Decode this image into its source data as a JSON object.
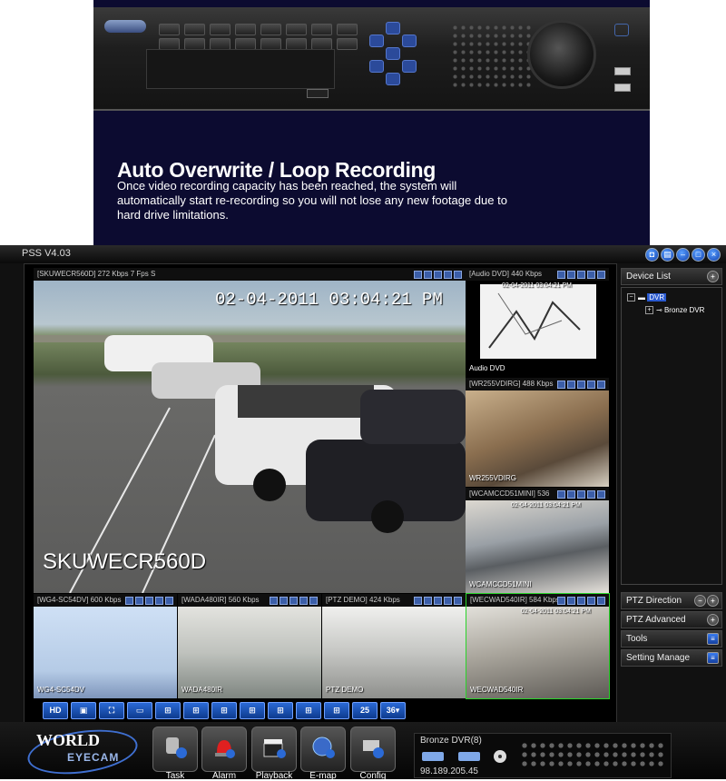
{
  "hero": {
    "title": "Auto Overwrite / Loop Recording",
    "description": "Once video recording capacity has been reached, the system will automatically start re-recording so you will not lose any new footage due to hard drive limitations."
  },
  "app": {
    "title": "PSS  V4.03"
  },
  "main_view": {
    "header": "[SKUWECR560D]  272 Kbps 7 Fps S",
    "timestamp": "02-04-2011  03:04:21 PM",
    "overlay_name": "SKUWECR560D"
  },
  "side_panes": [
    {
      "header": "[Audio DVD]  440 Kbps",
      "label": "Audio DVD",
      "timestamp": "02-04-2011  03:04:21 PM"
    },
    {
      "header": "[WR255VDIRG]  488 Kbps",
      "label": "WR255VDIRG",
      "timestamp": ""
    },
    {
      "header": "[WCAMCCD51MINI]  536",
      "label": "WCAMCCD51MINI",
      "timestamp": "02-04-2011  03:04:21 PM"
    }
  ],
  "bottom_panes": [
    {
      "header": "[WG4-SC54DV]  600 Kbps",
      "label": "WG4-SC54DV",
      "timestamp": ""
    },
    {
      "header": "[WADA480IR]  560 Kbps",
      "label": "WADA480IR",
      "timestamp": ""
    },
    {
      "header": "[PTZ DEMO]  424 Kbps",
      "label": "PTZ DEMO",
      "timestamp": ""
    },
    {
      "header": "[WECWAD540IR]  584 Kbps",
      "label": "WECWAD540IR",
      "timestamp": "02-04-2011  03:04:21 PM"
    }
  ],
  "toolbar": {
    "hd_label": "HD",
    "layout_25_label": "25",
    "layout_36_label": "36▾"
  },
  "right_panel": {
    "device_list": "Device List",
    "tree_root": "DVR",
    "tree_child": "Bronze DVR",
    "ptz_direction": "PTZ Direction",
    "ptz_advanced": "PTZ Advanced",
    "tools": "Tools",
    "setting_manage": "Setting Manage"
  },
  "dock": {
    "brand_world": "WORLD",
    "brand_eyecam": "EYECAM",
    "buttons": [
      {
        "label": "Task"
      },
      {
        "label": "Alarm"
      },
      {
        "label": "Playback"
      },
      {
        "label": "E-map"
      },
      {
        "label": "Config"
      }
    ],
    "device_name": "Bronze DVR(8)",
    "device_ip": "98.189.205.45"
  },
  "colors": {
    "hero_bg": "#0c0b30",
    "accent_blue": "#2b6ad6",
    "selected_pane": "#2bd42b"
  }
}
